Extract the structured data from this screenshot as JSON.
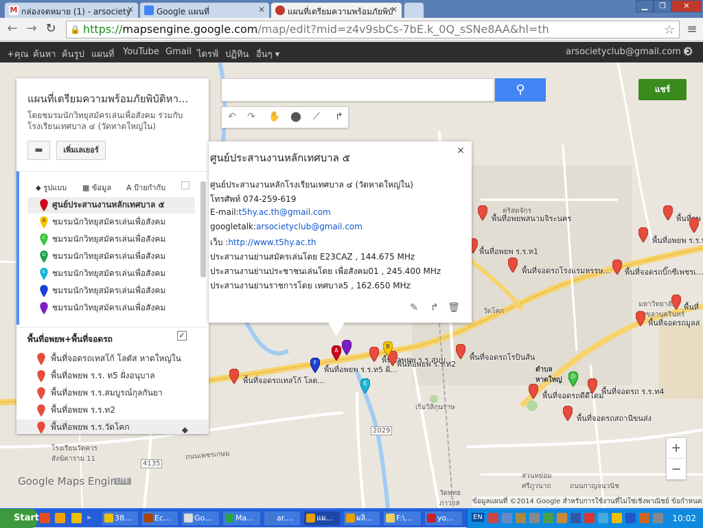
{
  "browser": {
    "tabs": [
      {
        "title": "กล่องจดหมาย (1) - arsociety",
        "favicon_color": "#d93025"
      },
      {
        "title": "Google แผนที่",
        "favicon_color": "#4285f4"
      },
      {
        "title": "แผนที่เตรียมความพร้อมภัยพิบั",
        "favicon_color": "#c0392b"
      }
    ],
    "url_scheme": "https://",
    "url_host": "mapsengine.google.com",
    "url_path": "/map/edit?mid=z4v9sbCs-7bE.k_0Q_sSNe8AA&hl=th",
    "window_controls": {
      "minimize": "▁",
      "maximize": "❐",
      "close": "✕"
    },
    "nav": {
      "back": "←",
      "forward": "→",
      "reload": "↻"
    }
  },
  "google_bar": {
    "items": [
      "+คุณ",
      "ค้นหา",
      "ค้นรูป",
      "แผนที่",
      "YouTube",
      "Gmail",
      "ไดรฟ์",
      "ปฏิทิน",
      "อื่นๆ ▾"
    ],
    "account": "arsocietyclub@gmail.com ▾"
  },
  "map_ui": {
    "share_label": "แชร์",
    "search_placeholder": "",
    "search_icon": "search-icon",
    "zoom_in": "+",
    "zoom_out": "−",
    "logo": "Google  Maps Engine",
    "lite_badge": "LITE",
    "copyright": "ข้อมูลแผนที่ ©2014 Google   สำหรับการใช้งานที่ไม่ใช่เชิงพาณิชย์   ข้อกำหนด"
  },
  "panel": {
    "title": "แผนที่เตรียมความพร้อมภัยพิบัติหา...",
    "description": "โดยชมรมนักวิทยุสมัครเล่นเพื่อสังคม ร่วมกับ โรงเรียนเทศบาล ๔ (วัดหาดใหญ่ใน)",
    "add_layer": "เพิ่มเลเยอร์",
    "layer1_tabs": {
      "style": "รูปแบบ",
      "data": "ข้อมูล",
      "labels": "ป้ายกำกับ"
    },
    "layer1_items": [
      {
        "label": "ศูนย์ประสานงานหลักเทศบาล ๕",
        "color": "#d0021b",
        "letter": ""
      },
      {
        "label": "ชมรมนักวิทยุสมัครเล่นเพื่อสังคม",
        "color": "#f5c400",
        "letter": "B"
      },
      {
        "label": "ชมรมนักวิทยุสมัครเล่นเพื่อสังคม",
        "color": "#3cc43c",
        "letter": "C"
      },
      {
        "label": "ชมรมนักวิทยุสมัครเล่นเพื่อสังคม",
        "color": "#1aa34a",
        "letter": "D"
      },
      {
        "label": "ชมรมนักวิทยุสมัครเล่นเพื่อสังคม",
        "color": "#19b5d6",
        "letter": "E"
      },
      {
        "label": "ชมรมนักวิทยุสมัครเล่นเพื่อสังคม",
        "color": "#1a3fd6",
        "letter": ""
      },
      {
        "label": "ชมรมนักวิทยุสมัครเล่นเพื่อสังคม",
        "color": "#7b1fc4",
        "letter": ""
      }
    ],
    "layer2_title": "พื้นที่อพยพ+พื้นที่จอดรถ",
    "layer2_check": "✓",
    "layer2_items": [
      "พื้นที่จอดรถเทสโก้ โลตัส หาดใหญ่ใน",
      "พื้นที่อพยพ ร.ร. ท5 ฝั่งอนุบาล",
      "พื้นที่อพยพ ร.ร.สมบูรณ์กุลกันยา",
      "พื้นที่อพยพ ร.ร.ท2",
      "พื้นที่อพยพ ร.ร.วัดโคก"
    ]
  },
  "bubble": {
    "title": "ศูนย์ประสานงานหลักเทศบาล ๕",
    "line1": "ศูนย์ประสานงานหลักโรงเรียนเทศบาล ๔ (วัดหาดใหญ่ใน)",
    "line2": "โทรศัพท์ 074-259-619",
    "email_prefix": "E-mail:",
    "email": "t5hy.ac.th@gmail.com",
    "gtalk_prefix": "googletalk:",
    "gtalk": "arsocietyclub@gmail.com",
    "web_prefix": "เว็บ :",
    "web": "http://www.t5hy.ac.th",
    "line6": "ประสานงานย่านสมัครเล่นโดย E23CAZ , 144.675 MHz",
    "line7": "ประสานงานย่านประชาชนเล่นโดย เพื่อสังคม01 , 245.400 MHz",
    "line8": "ประสานงานย่านราชการโดย เทศบาล5 , 162.650 MHz"
  },
  "map_labels": [
    {
      "text": "พื้นที่อพยพสนามจิระนคร"
    },
    {
      "text": "พื้นที่อพ"
    },
    {
      "text": "พื้นที่อพยพ ร.ร.ท"
    },
    {
      "text": "พื้นที่อพยพ ร.ร.ท1"
    },
    {
      "text": "พื้นที่จอดรถโรงแรมหรรษ..."
    },
    {
      "text": "พื้นที่จอดรถบิ๊กซีเพชรเ..."
    },
    {
      "text": "พื้นที่"
    },
    {
      "text": "พื้นที่จอดรถมูลส"
    },
    {
      "text": "พื้นที่อพยพ ร.ร.ท5 ฝั่..."
    },
    {
      "text": "พื้นที่อพยพ ร.ร.สมบู..."
    },
    {
      "text": "พื้นที่อพยพ ร.ร.ท2"
    },
    {
      "text": "พื้นที่จอดรถโรบินสัน"
    },
    {
      "text": "พื้นที่จอดรถเทสโก้ โลต..."
    },
    {
      "text": "พื้นที่จอดรถดีดีโดม"
    },
    {
      "text": "พื้นที่จอดรถ ร.ร.ท4"
    },
    {
      "text": "พื้นที่จอดรถสถานีขนส่ง"
    },
    {
      "text": "วัดโคก"
    }
  ],
  "place_labels": [
    {
      "text": "คริสตจักร"
    },
    {
      "text": "หาดใหญ่"
    },
    {
      "text": "ถนนเพชรเกษม"
    },
    {
      "text": "โรงเรียนวัดควร\nสังฆิตาราม 11"
    },
    {
      "text": "สวนหย่อม\nศรีภูวนาถ"
    },
    {
      "text": "ตำบล\nหาดใหญ่"
    },
    {
      "text": "มหาวิทยาลัย\nสงขลานครินทร์"
    },
    {
      "text": "วัดพุทธ\nภาวาส"
    },
    {
      "text": "2029"
    },
    {
      "text": "4135"
    },
    {
      "text": "เริ่มวิลิกุนราษ"
    },
    {
      "text": "ถนนกาญจนวนิช"
    }
  ],
  "taskbar": {
    "start": "Start",
    "tasks": [
      {
        "label": "38...",
        "color": "#f0c000"
      },
      {
        "label": "Ec...",
        "color": "#aa4400"
      },
      {
        "label": "Go...",
        "color": "#dddddd"
      },
      {
        "label": "Ma...",
        "color": "#2aa44a"
      },
      {
        "label": "ar....",
        "color": "#4477cc"
      },
      {
        "label": "แผ...",
        "color": "#e8a000"
      },
      {
        "label": "ผลิ...",
        "color": "#e8a000"
      },
      {
        "label": "F:\\...",
        "color": "#f0d060"
      },
      {
        "label": "yo...",
        "color": "#cc2222"
      }
    ],
    "lang": "EN",
    "clock": "10:02"
  }
}
